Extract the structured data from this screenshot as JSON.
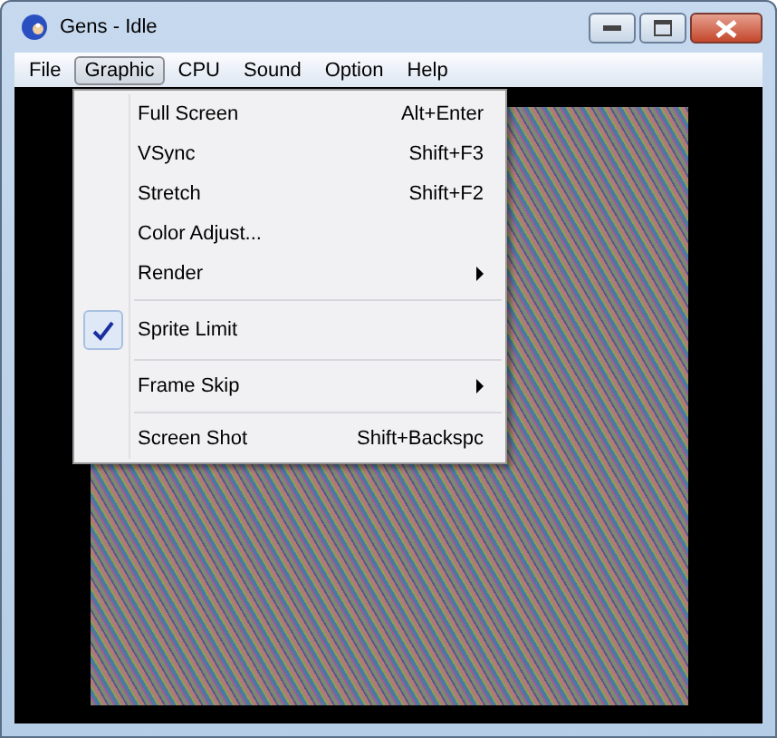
{
  "window": {
    "title": "Gens - Idle"
  },
  "menu_bar": [
    {
      "label": "File",
      "selected": false
    },
    {
      "label": "Graphic",
      "selected": true
    },
    {
      "label": "CPU",
      "selected": false
    },
    {
      "label": "Sound",
      "selected": false
    },
    {
      "label": "Option",
      "selected": false
    },
    {
      "label": "Help",
      "selected": false
    }
  ],
  "dropdown": [
    {
      "kind": "item",
      "label": "Full Screen",
      "shortcut": "Alt+Enter",
      "checked": false,
      "submenu": false
    },
    {
      "kind": "item",
      "label": "VSync",
      "shortcut": "Shift+F3",
      "checked": false,
      "submenu": false
    },
    {
      "kind": "item",
      "label": "Stretch",
      "shortcut": "Shift+F2",
      "checked": false,
      "submenu": false
    },
    {
      "kind": "item",
      "label": "Color Adjust...",
      "checked": false,
      "submenu": false
    },
    {
      "kind": "item",
      "label": "Render",
      "checked": false,
      "submenu": true
    },
    {
      "kind": "separator"
    },
    {
      "kind": "item",
      "label": "Sprite Limit",
      "checked": true,
      "submenu": false
    },
    {
      "kind": "separator"
    },
    {
      "kind": "item",
      "label": "Frame Skip",
      "checked": false,
      "submenu": true
    },
    {
      "kind": "separator"
    },
    {
      "kind": "item",
      "label": "Screen Shot",
      "shortcut": "Shift+Backspc",
      "checked": false,
      "submenu": false
    }
  ]
}
